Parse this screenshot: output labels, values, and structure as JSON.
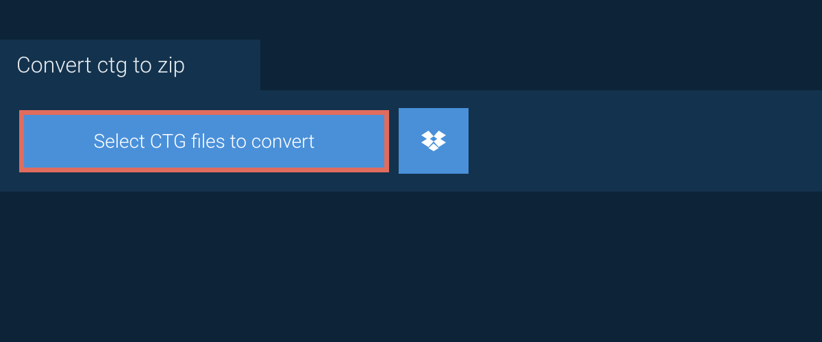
{
  "tab": {
    "title": "Convert ctg to zip"
  },
  "actions": {
    "select_label": "Select CTG files to convert"
  },
  "colors": {
    "bg_outer": "#0d2438",
    "bg_panel": "#13324d",
    "button_blue": "#4a90d9",
    "button_border": "#e06c5e",
    "text_light": "#e8edf1"
  },
  "icons": {
    "dropbox": "dropbox-icon"
  }
}
